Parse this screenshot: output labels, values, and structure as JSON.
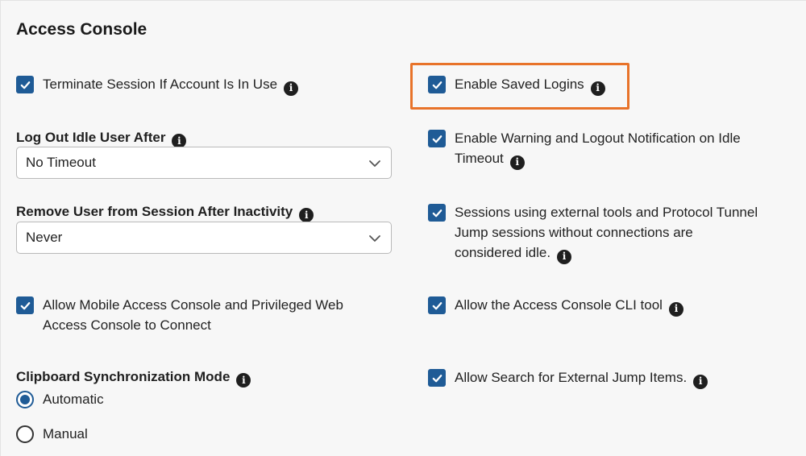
{
  "title": "Access Console",
  "highlight_color": "#e8732a",
  "accent_color": "#1f5b96",
  "left": {
    "terminate": {
      "label": "Terminate Session If Account Is In Use",
      "checked": true
    },
    "idle_logout": {
      "label": "Log Out Idle User After",
      "value": "No Timeout"
    },
    "remove_user": {
      "label": "Remove User from Session After Inactivity",
      "value": "Never"
    },
    "mobile": {
      "label_line1": "Allow Mobile Access Console and Privileged Web",
      "label_line2": "Access Console to Connect",
      "checked": true
    },
    "clipboard": {
      "label": "Clipboard Synchronization Mode",
      "options": [
        {
          "label": "Automatic",
          "selected": true
        },
        {
          "label": "Manual",
          "selected": false
        }
      ]
    }
  },
  "right": {
    "saved_logins": {
      "label": "Enable Saved Logins",
      "checked": true
    },
    "warning": {
      "label_line1": "Enable Warning and Logout Notification on Idle",
      "label_line2": "Timeout",
      "checked": true
    },
    "external": {
      "label_line1": "Sessions using external tools and Protocol Tunnel",
      "label_line2": "Jump sessions without connections are",
      "label_line3": "considered idle.",
      "checked": true
    },
    "cli": {
      "label": "Allow the Access Console CLI tool",
      "checked": true
    },
    "search": {
      "label": "Allow Search for External Jump Items.",
      "checked": true
    }
  }
}
